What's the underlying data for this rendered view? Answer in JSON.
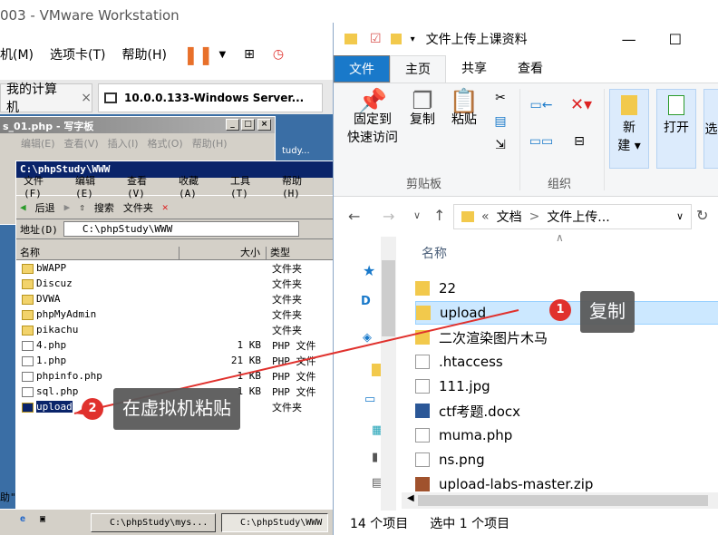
{
  "vmware": {
    "title": "003 - VMware Workstation",
    "menu": [
      "机(M)",
      "选项卡(T)",
      "帮助(H)"
    ],
    "tabs": [
      {
        "label": "我的计算机"
      },
      {
        "label": "10.0.0.133-Windows Server..."
      }
    ],
    "close": "×"
  },
  "wordpad": {
    "title": "s_01.php - 写字板",
    "menu": [
      "编辑(E)",
      "查看(V)",
      "插入(I)",
      "格式(O)",
      "帮助(H)"
    ],
    "side_text": "tudy..."
  },
  "explorer": {
    "title": "C:\\phpStudy\\WWW",
    "menu": [
      "文件(F)",
      "编辑(E)",
      "查看(V)",
      "收藏(A)",
      "工具(T)",
      "帮助(H)"
    ],
    "toolbar": {
      "back": "后退",
      "search": "搜索",
      "folders": "文件夹"
    },
    "address_label": "地址(D)",
    "address": "C:\\phpStudy\\WWW",
    "columns": [
      "名称",
      "大小",
      "类型"
    ],
    "rows": [
      {
        "name": "bWAPP",
        "size": "",
        "type": "文件夹",
        "kind": "folder"
      },
      {
        "name": "Discuz",
        "size": "",
        "type": "文件夹",
        "kind": "folder"
      },
      {
        "name": "DVWA",
        "size": "",
        "type": "文件夹",
        "kind": "folder"
      },
      {
        "name": "phpMyAdmin",
        "size": "",
        "type": "文件夹",
        "kind": "folder"
      },
      {
        "name": "pikachu",
        "size": "",
        "type": "文件夹",
        "kind": "folder"
      },
      {
        "name": "4.php",
        "size": "1 KB",
        "type": "PHP 文件",
        "kind": "file"
      },
      {
        "name": "1.php",
        "size": "21 KB",
        "type": "PHP 文件",
        "kind": "file"
      },
      {
        "name": "phpinfo.php",
        "size": "1 KB",
        "type": "PHP 文件",
        "kind": "file"
      },
      {
        "name": "sql.php",
        "size": "1 KB",
        "type": "PHP 文件",
        "kind": "file"
      },
      {
        "name": "upload",
        "size": "",
        "type": "文件夹",
        "kind": "folder",
        "selected": true
      }
    ]
  },
  "taskbar": {
    "items": [
      "C:\\phpStudy\\mys...",
      "C:\\phpStudy\\WWW"
    ],
    "left_text": "助\""
  },
  "win10": {
    "title": "文件上传上课资料",
    "ribbon_tabs": [
      "文件",
      "主页",
      "共享",
      "查看"
    ],
    "ribbon": {
      "pin": "固定到\n快速访问",
      "copy": "复制",
      "paste": "粘贴",
      "clipboard": "剪贴板",
      "organize": "组织",
      "new": "新\n建 ▾",
      "open": "打开",
      "select": "选",
      "cut_icon": "scissors-icon"
    },
    "path": [
      "«",
      "文档",
      ">",
      "文件上传..."
    ],
    "column_name": "名称",
    "items": [
      {
        "name": "22",
        "kind": "folder"
      },
      {
        "name": "upload",
        "kind": "folder",
        "selected": true
      },
      {
        "name": "二次渲染图片木马",
        "kind": "folder"
      },
      {
        "name": ".htaccess",
        "kind": "file"
      },
      {
        "name": "111.jpg",
        "kind": "file"
      },
      {
        "name": "ctf考题.docx",
        "kind": "word"
      },
      {
        "name": "muma.php",
        "kind": "file"
      },
      {
        "name": "ns.png",
        "kind": "file"
      },
      {
        "name": "upload-labs-master.zip",
        "kind": "zip"
      }
    ],
    "status": {
      "count": "14 个项目",
      "selected": "选中 1 个项目"
    }
  },
  "annotations": [
    {
      "number": "1",
      "text": "复制"
    },
    {
      "number": "2",
      "text": "在虚拟机粘贴"
    }
  ],
  "colors": {
    "accent": "#1979ca",
    "badge": "#e0312d",
    "xp_title": "#0a246a",
    "arrow": "#e0312d"
  }
}
